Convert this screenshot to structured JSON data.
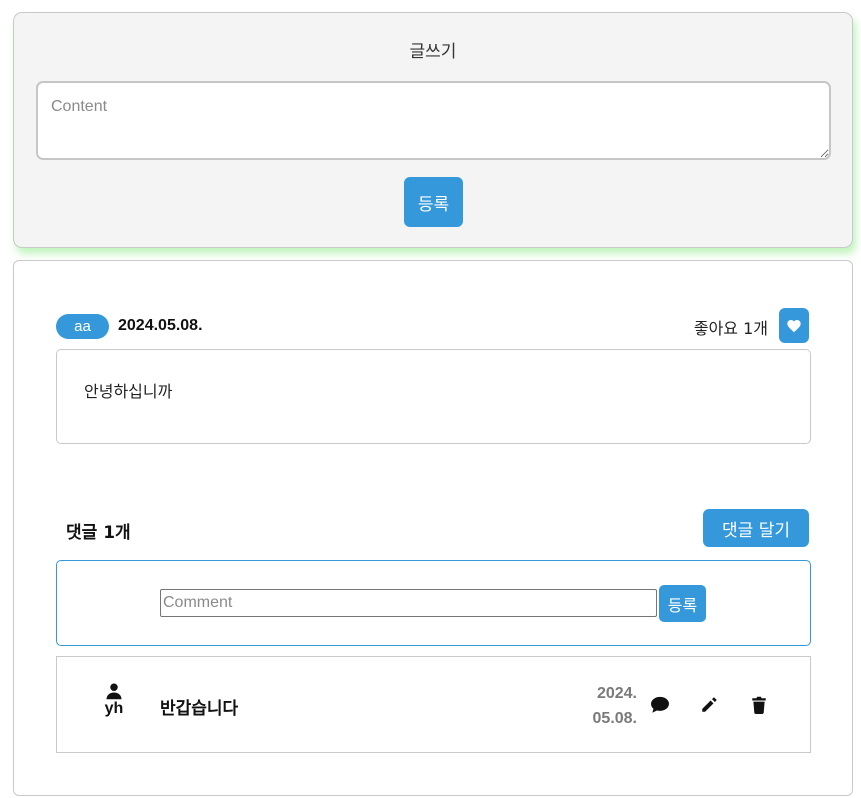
{
  "compose": {
    "title": "글쓰기",
    "content_placeholder": "Content",
    "content_value": "",
    "submit_label": "등록"
  },
  "post": {
    "author": "aa",
    "date": "2024.05.08.",
    "likes_label": "좋아요 1개",
    "like_icon": "heart-icon",
    "content": "안녕하십니까"
  },
  "comments": {
    "count_label": "댓글 1개",
    "add_button_label": "댓글 달기",
    "input_placeholder": "Comment",
    "input_value": "",
    "submit_label": "등록",
    "items": [
      {
        "user_icon": "person-icon",
        "author": "yh",
        "text": "반갑습니다",
        "date_line1": "2024.",
        "date_line2": "05.08.",
        "reply_icon": "speech-bubble-icon",
        "edit_icon": "pencil-icon",
        "delete_icon": "trash-icon"
      }
    ]
  },
  "colors": {
    "accent": "#3498db",
    "compose_bg": "#f4f4f4",
    "shadow_glow": "#78e66e"
  }
}
